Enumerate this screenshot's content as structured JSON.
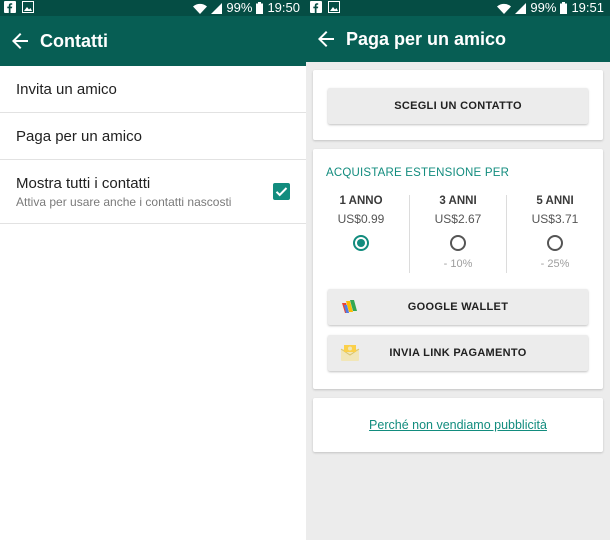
{
  "left_screen": {
    "status_bar": {
      "battery": "99%",
      "time": "19:50"
    },
    "app_bar": {
      "title": "Contatti"
    },
    "list": [
      {
        "title": "Invita un amico"
      },
      {
        "title": "Paga per un amico"
      },
      {
        "title": "Mostra tutti i contatti",
        "subtitle": "Attiva per usare anche i contatti nascosti",
        "checked": true
      }
    ]
  },
  "right_screen": {
    "status_bar": {
      "battery": "99%",
      "time": "19:51"
    },
    "app_bar": {
      "title": "Paga per un amico"
    },
    "choose_contact": {
      "label": "SCEGLI UN CONTATTO"
    },
    "extension": {
      "heading": "ACQUISTARE ESTENSIONE PER",
      "plans": [
        {
          "name": "1 ANNO",
          "price": "US$0.99",
          "discount": "",
          "selected": true
        },
        {
          "name": "3 ANNI",
          "price": "US$2.67",
          "discount": "- 10%",
          "selected": false
        },
        {
          "name": "5 ANNI",
          "price": "US$3.71",
          "discount": "- 25%",
          "selected": false
        }
      ],
      "google_wallet_label": "GOOGLE WALLET",
      "payment_link_label": "INVIA LINK PAGAMENTO"
    },
    "why_link": "Perché non vendiamo pubblicità"
  },
  "colors": {
    "status_bar": "#054d44",
    "app_bar": "#075e54",
    "accent": "#128c7e",
    "background": "#ececec"
  },
  "icons": [
    "facebook-icon",
    "image-icon",
    "wifi-icon",
    "signal-icon",
    "battery-icon",
    "back-arrow-icon",
    "checkbox-checked-icon",
    "google-wallet-icon",
    "payment-link-icon"
  ]
}
